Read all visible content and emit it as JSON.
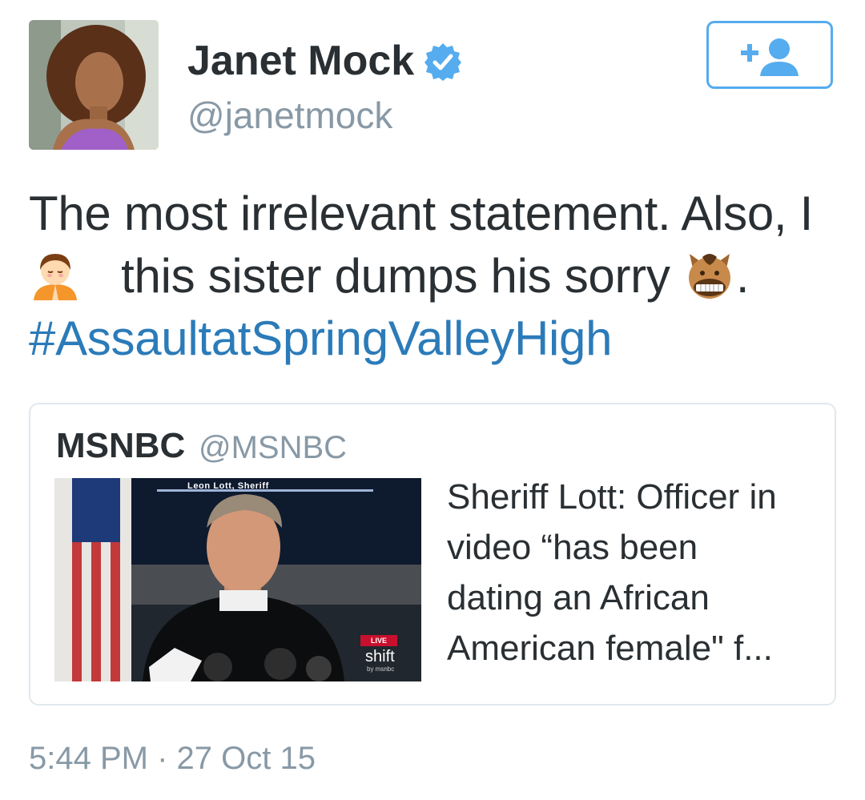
{
  "author": {
    "display_name": "Janet Mock",
    "handle": "@janetmock",
    "verified_icon": "verified-badge-icon",
    "avatar": "profile-photo"
  },
  "follow_button": {
    "icon": "add-user-icon"
  },
  "tweet": {
    "line1": "The most irrelevant statement. Also, I",
    "emoji1": "person-with-folded-hands-icon",
    "line2": "this sister dumps his sorry",
    "emoji2": "horse-face-icon",
    "line2_end": ".",
    "hashtag": "#AssaultatSpringValleyHigh"
  },
  "quoted_tweet": {
    "name": "MSNBC",
    "handle": "@MSNBC",
    "thumbnail": {
      "banner": "Leon Lott, Sheriff",
      "live": "LIVE",
      "logo": "shift",
      "logo_sub": "by msnbc"
    },
    "headline_lines": [
      "Sheriff Lott: Officer in",
      "video “has been",
      "dating an African",
      "American female\" f..."
    ]
  },
  "timestamp": "5:44 PM · 27 Oct 15",
  "colors": {
    "link": "#2b7bb9",
    "accent": "#55acee",
    "muted": "#8899a6",
    "text": "#292f33",
    "border": "#e1e8ed"
  }
}
